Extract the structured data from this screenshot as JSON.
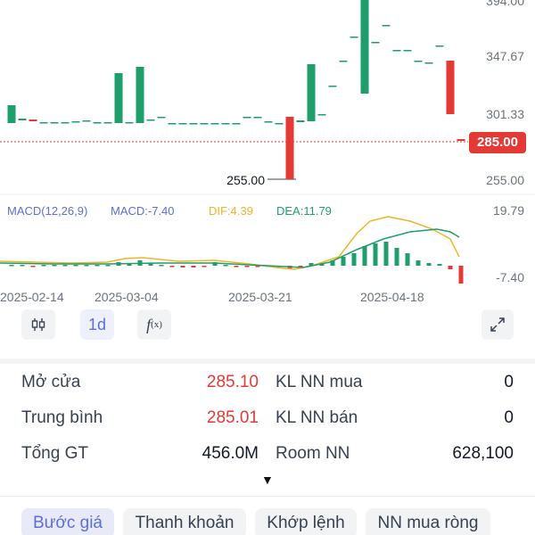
{
  "price_axis": {
    "top_partial": "394.00",
    "labels": [
      "347.67",
      "301.33",
      "255.00"
    ],
    "current_price": "285.00",
    "low_marker": "255.00"
  },
  "macd": {
    "legend": {
      "title": "MACD(12,26,9)",
      "macd": "MACD:-7.40",
      "dif": "DIF:4.39",
      "dea": "DEA:11.79"
    },
    "axis_top": "19.79",
    "axis_bottom": "-7.40"
  },
  "dates": [
    "2025-02-14",
    "2025-03-04",
    "2025-03-21",
    "2025-04-18"
  ],
  "colors": {
    "up": "#1e9e6a",
    "down": "#e53935",
    "dif": "#f0b429",
    "dea": "#1e9e6a",
    "accent": "#5b6fd6"
  },
  "toolbar": {
    "candle_icon": "candlestick-icon",
    "interval": "1d",
    "indicator_icon": "function-icon",
    "expand_icon": "fullscreen-icon"
  },
  "stats": {
    "open_label": "Mở cửa",
    "open_value": "285.10",
    "avg_label": "Trung bình",
    "avg_value": "285.01",
    "total_label": "Tổng GT",
    "total_value": "456.0M",
    "buy_label": "KL NN mua",
    "buy_value": "0",
    "sell_label": "KL NN bán",
    "sell_value": "0",
    "room_label": "Room NN",
    "room_value": "628,100"
  },
  "tabs": [
    "Bước giá",
    "Thanh khoản",
    "Khớp lệnh",
    "NN mua ròng"
  ]
}
